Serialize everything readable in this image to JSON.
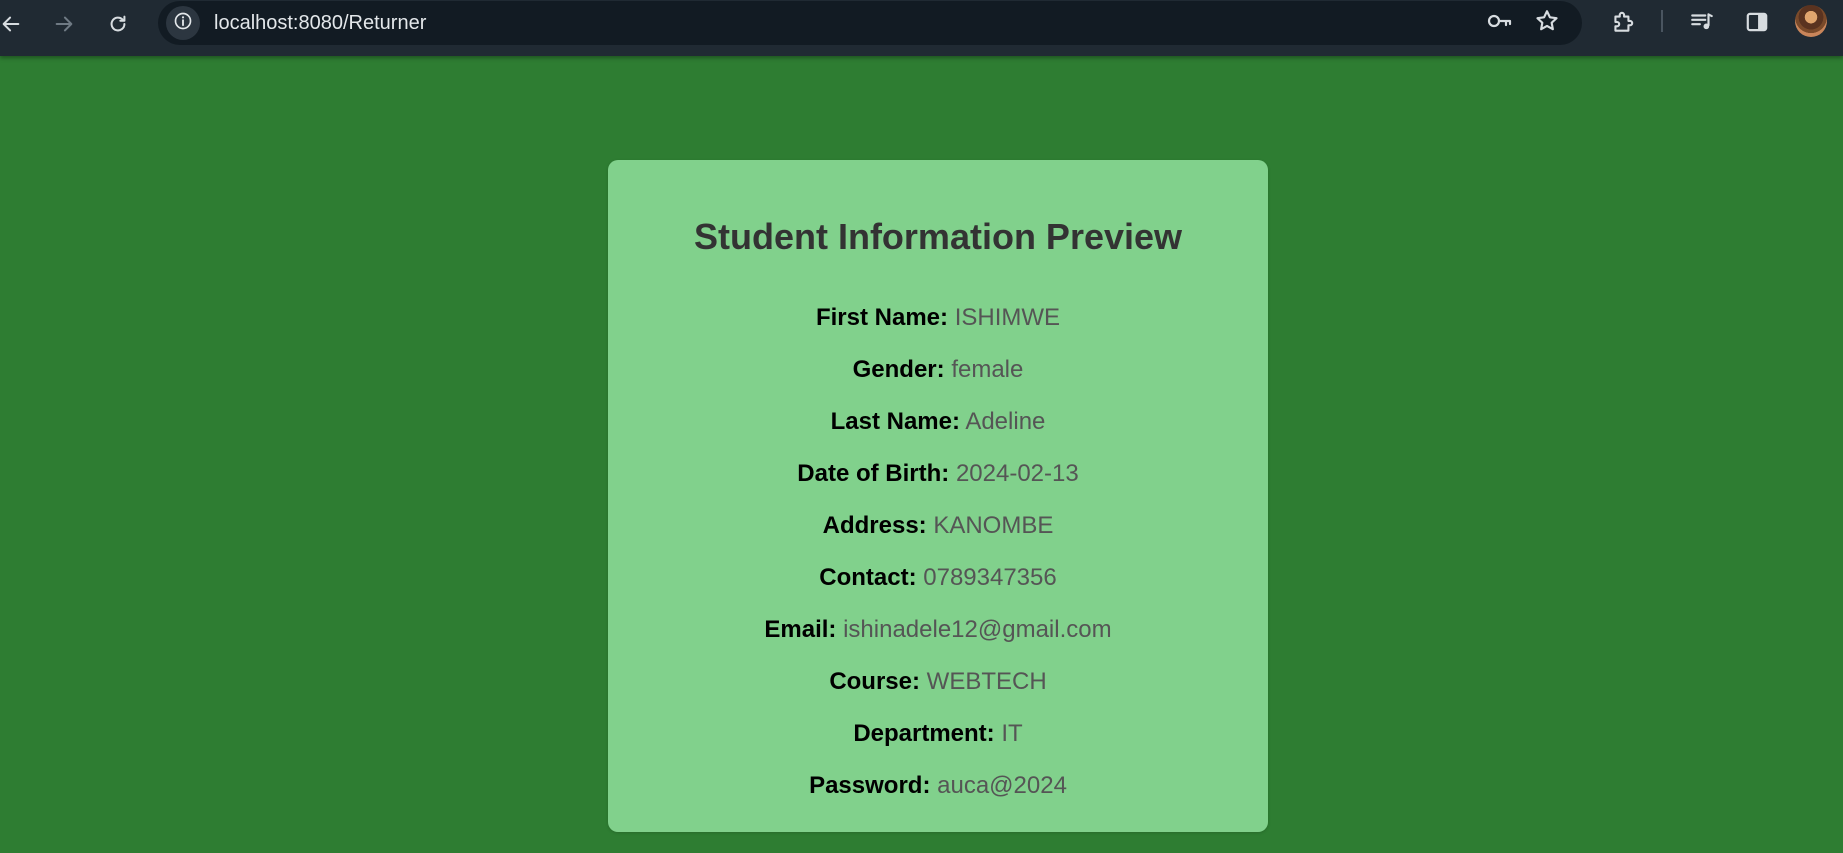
{
  "browser": {
    "url": "localhost:8080/Returner",
    "icons": {
      "back": "arrow-left-icon",
      "forward": "arrow-right-icon",
      "reload": "reload-icon",
      "site_info": "info-icon",
      "password": "key-icon",
      "bookmark": "star-icon",
      "extensions": "puzzle-icon",
      "media": "playlist-icon",
      "side_panel": "side-panel-icon",
      "profile": "avatar"
    }
  },
  "colors": {
    "page_background": "#2e7d32",
    "card_background": "#81d18c",
    "title": "#333333",
    "label": "#000000",
    "value": "#555555"
  },
  "card": {
    "title": "Student Information Preview",
    "fields": [
      {
        "label": "First Name:",
        "value": "ISHIMWE"
      },
      {
        "label": "Gender:",
        "value": "female"
      },
      {
        "label": "Last Name:",
        "value": "Adeline"
      },
      {
        "label": "Date of Birth:",
        "value": "2024-02-13"
      },
      {
        "label": "Address:",
        "value": "KANOMBE"
      },
      {
        "label": "Contact:",
        "value": "0789347356"
      },
      {
        "label": "Email:",
        "value": "ishinadele12@gmail.com"
      },
      {
        "label": "Course:",
        "value": "WEBTECH"
      },
      {
        "label": "Department:",
        "value": "IT"
      },
      {
        "label": "Password:",
        "value": "auca@2024"
      }
    ]
  }
}
